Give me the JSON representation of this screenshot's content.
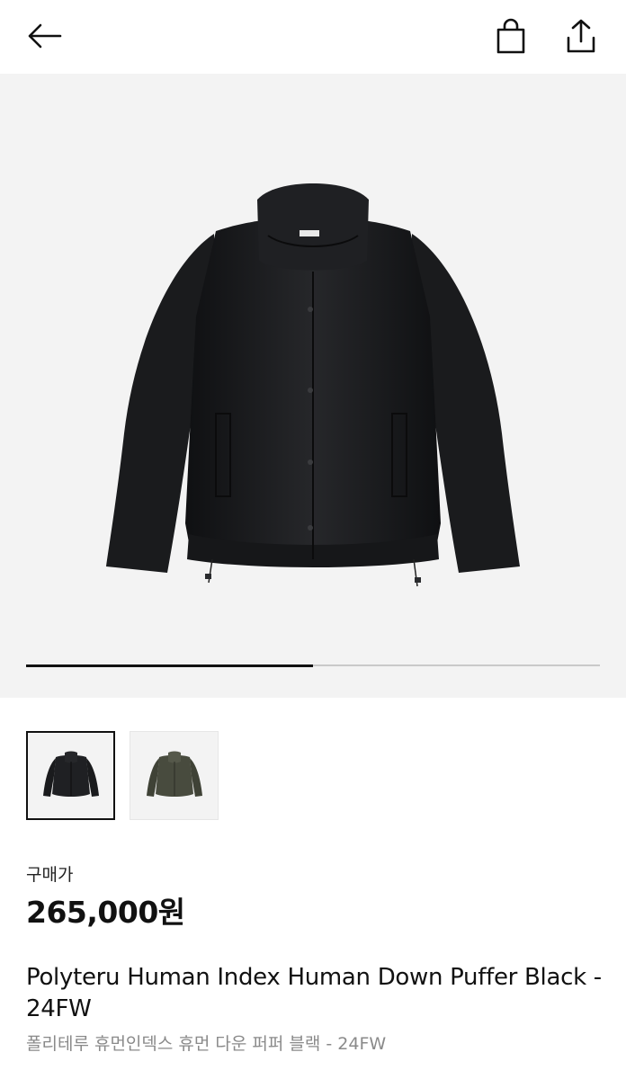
{
  "header": {
    "back_icon": "arrow-left-icon",
    "bag_icon": "shopping-bag-icon",
    "share_icon": "share-upload-icon"
  },
  "gallery": {
    "current_image": 1,
    "total_images": 2,
    "progress_fraction": 0.5,
    "jacket_color_primary": "#1b1c1e",
    "jacket_color_alt": "#44473a",
    "background": "#f3f3f3"
  },
  "thumbnails": [
    {
      "variant": "black",
      "selected": true
    },
    {
      "variant": "khaki",
      "selected": false
    }
  ],
  "product": {
    "price_label": "구매가",
    "price": "265,000원",
    "name_en": "Polyteru Human Index Human Down Puffer Black - 24FW",
    "name_ko": "폴리테루 휴먼인덱스 휴먼 다운 퍼퍼 블랙 - 24FW"
  }
}
